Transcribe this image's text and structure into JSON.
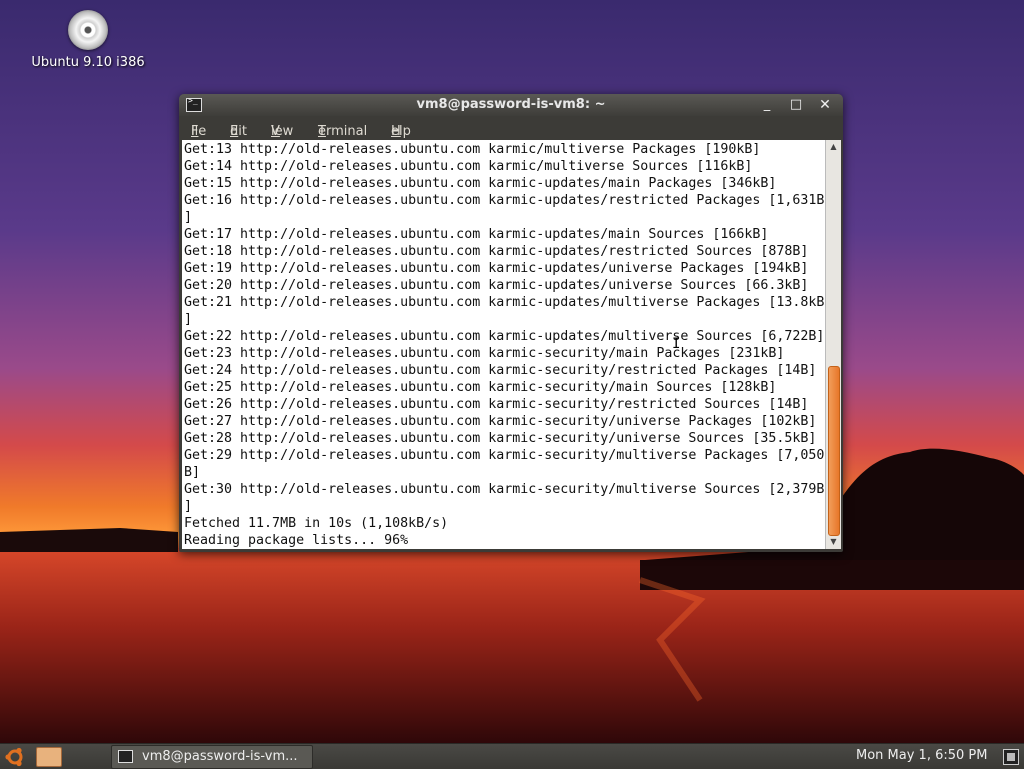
{
  "desktop": {
    "icon_label": "Ubuntu 9.10 i386"
  },
  "window": {
    "title": "vm8@password-is-vm8: ~",
    "buttons": {
      "minimize": "_",
      "maximize": "□",
      "close": "✕"
    },
    "menu": {
      "file": {
        "underlined": "F",
        "rest": "ile"
      },
      "edit": {
        "underlined": "E",
        "rest": "dit"
      },
      "view": {
        "underlined": "V",
        "rest": "iew"
      },
      "terminal": {
        "underlined": "T",
        "rest": "erminal"
      },
      "help": {
        "underlined": "H",
        "rest": "elp"
      }
    },
    "terminal_output": "Get:13 http://old-releases.ubuntu.com karmic/multiverse Packages [190kB]\nGet:14 http://old-releases.ubuntu.com karmic/multiverse Sources [116kB]\nGet:15 http://old-releases.ubuntu.com karmic-updates/main Packages [346kB]\nGet:16 http://old-releases.ubuntu.com karmic-updates/restricted Packages [1,631B\n]\nGet:17 http://old-releases.ubuntu.com karmic-updates/main Sources [166kB]\nGet:18 http://old-releases.ubuntu.com karmic-updates/restricted Sources [878B]\nGet:19 http://old-releases.ubuntu.com karmic-updates/universe Packages [194kB]\nGet:20 http://old-releases.ubuntu.com karmic-updates/universe Sources [66.3kB]\nGet:21 http://old-releases.ubuntu.com karmic-updates/multiverse Packages [13.8kB\n]\nGet:22 http://old-releases.ubuntu.com karmic-updates/multiverse Sources [6,722B]\nGet:23 http://old-releases.ubuntu.com karmic-security/main Packages [231kB]\nGet:24 http://old-releases.ubuntu.com karmic-security/restricted Packages [14B]\nGet:25 http://old-releases.ubuntu.com karmic-security/main Sources [128kB]\nGet:26 http://old-releases.ubuntu.com karmic-security/restricted Sources [14B]\nGet:27 http://old-releases.ubuntu.com karmic-security/universe Packages [102kB]\nGet:28 http://old-releases.ubuntu.com karmic-security/universe Sources [35.5kB]\nGet:29 http://old-releases.ubuntu.com karmic-security/multiverse Packages [7,050\nB]\nGet:30 http://old-releases.ubuntu.com karmic-security/multiverse Sources [2,379B\n]\nFetched 11.7MB in 10s (1,108kB/s)\nReading package lists... 96%"
  },
  "taskbar": {
    "task_label": "vm8@password-is-vm...",
    "clock": "Mon May  1,  6:50 PM"
  },
  "colors": {
    "accent_scroll_thumb": "#e7772a",
    "terminal_bg": "#ffffff",
    "window_chrome": "#3c3b37"
  }
}
